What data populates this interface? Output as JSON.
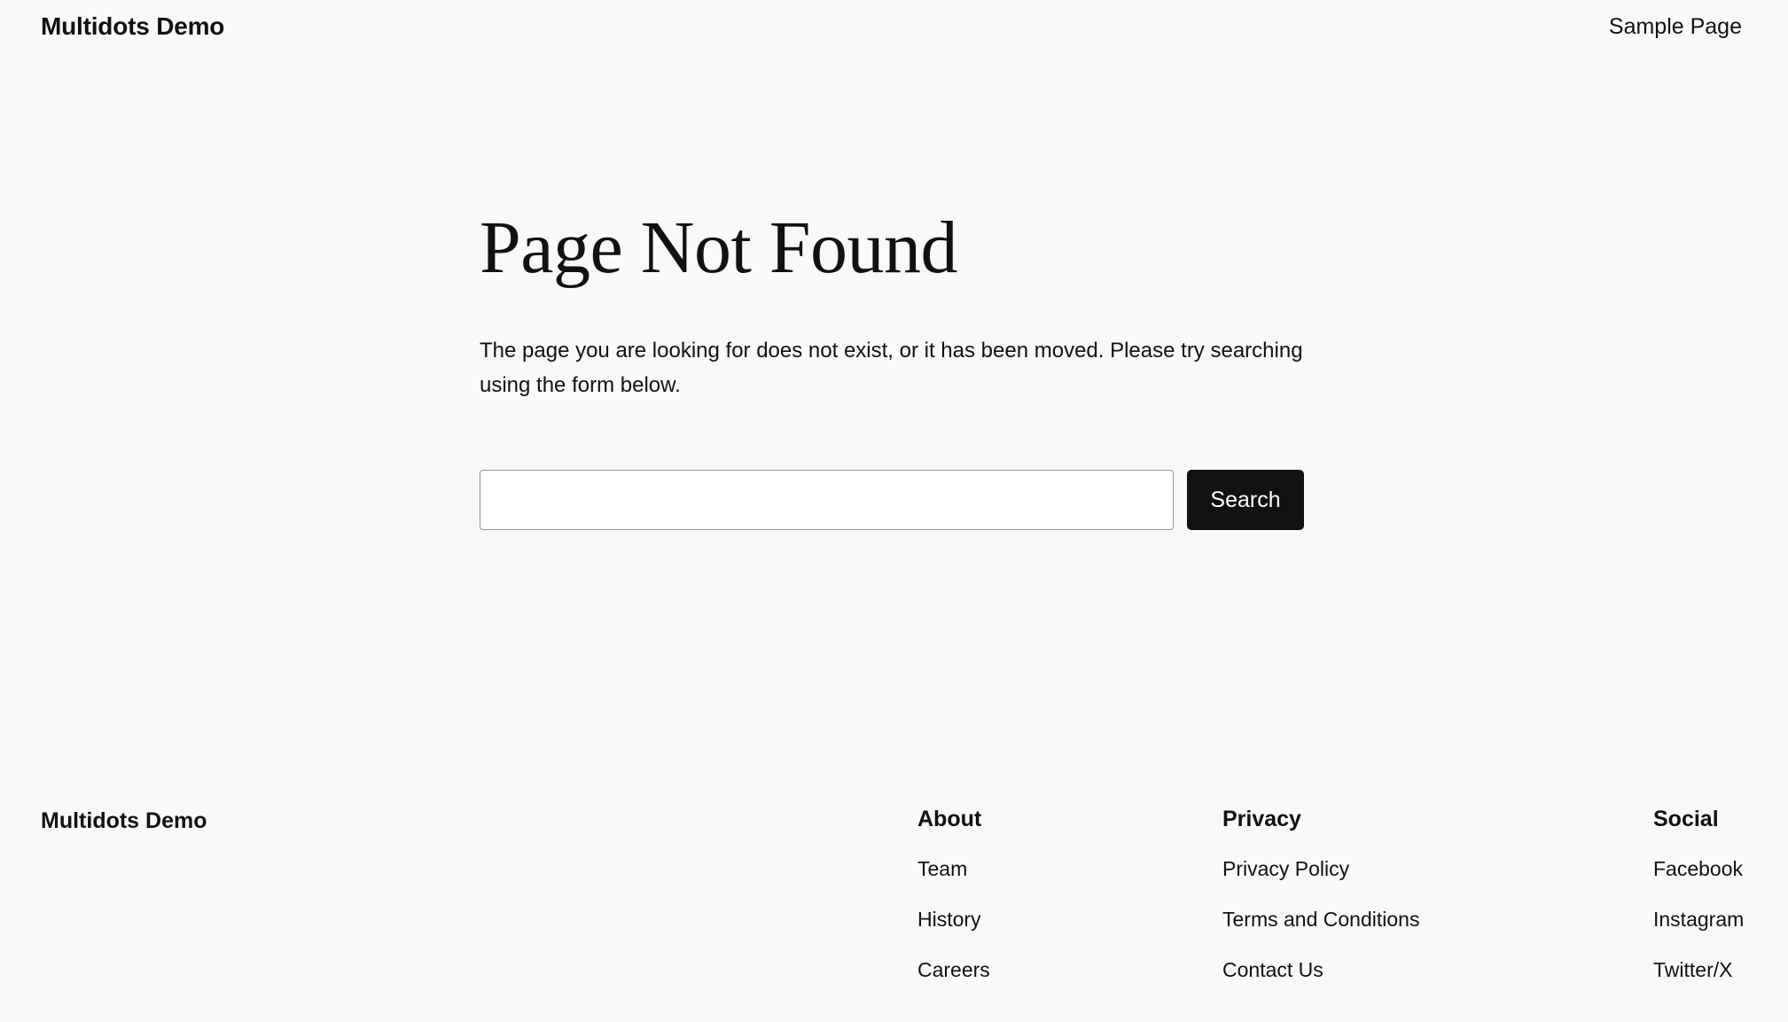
{
  "header": {
    "site_title": "Multidots Demo",
    "nav": [
      {
        "label": "Sample Page"
      }
    ]
  },
  "main": {
    "title": "Page Not Found",
    "description": "The page you are looking for does not exist, or it has been moved. Please try searching using the form below.",
    "search": {
      "value": "",
      "placeholder": "",
      "button_label": "Search"
    }
  },
  "footer": {
    "site_title": "Multidots Demo",
    "columns": [
      {
        "heading": "About",
        "links": [
          "Team",
          "History",
          "Careers"
        ]
      },
      {
        "heading": "Privacy",
        "links": [
          "Privacy Policy",
          "Terms and Conditions",
          "Contact Us"
        ]
      },
      {
        "heading": "Social",
        "links": [
          "Facebook",
          "Instagram",
          "Twitter/X"
        ]
      }
    ]
  },
  "colors": {
    "background": "#f9f9f9",
    "text": "#111111",
    "button_background": "#111111",
    "button_text": "#ffffff",
    "input_border": "#949494"
  }
}
